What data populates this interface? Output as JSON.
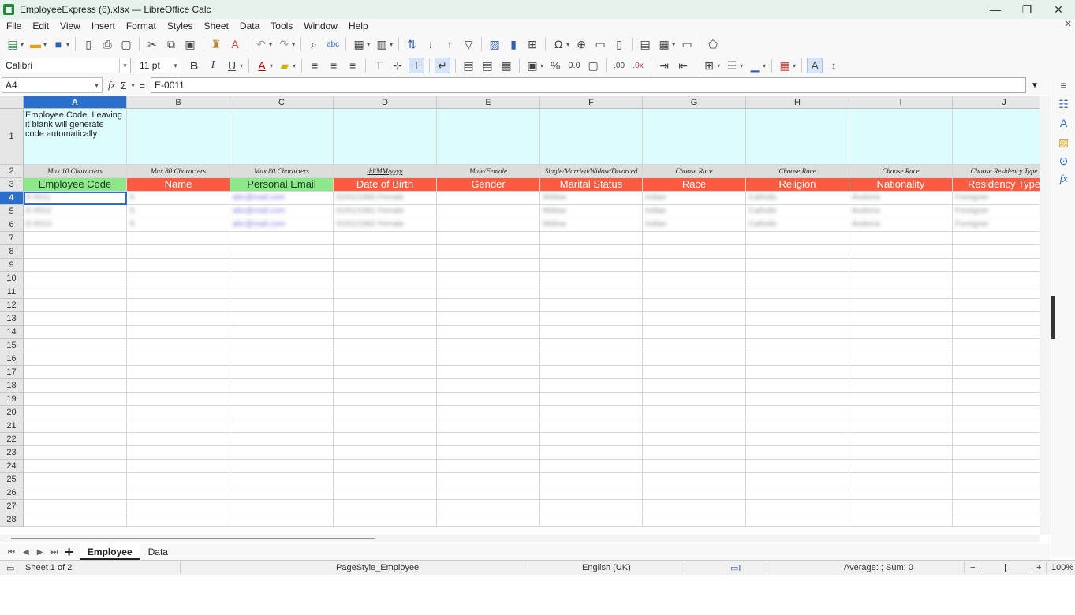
{
  "window": {
    "title": "EmployeeExpress (6).xlsx — LibreOffice Calc",
    "app_icon": "calc-app-icon",
    "controls": [
      "minimize",
      "restore",
      "close"
    ]
  },
  "menu": [
    "File",
    "Edit",
    "View",
    "Insert",
    "Format",
    "Styles",
    "Sheet",
    "Data",
    "Tools",
    "Window",
    "Help"
  ],
  "format_toolbar": {
    "font_name": "Calibri",
    "font_size": "11 pt"
  },
  "formula_bar": {
    "name_box": "A4",
    "content": "E-0011"
  },
  "columns": [
    {
      "letter": "A",
      "selected": true
    },
    {
      "letter": "B",
      "selected": false
    },
    {
      "letter": "C",
      "selected": false
    },
    {
      "letter": "D",
      "selected": false
    },
    {
      "letter": "E",
      "selected": false
    },
    {
      "letter": "F",
      "selected": false
    },
    {
      "letter": "G",
      "selected": false
    },
    {
      "letter": "H",
      "selected": false
    },
    {
      "letter": "I",
      "selected": false
    },
    {
      "letter": "J",
      "selected": false
    }
  ],
  "rows": {
    "numbers": [
      "1",
      "2",
      "3",
      "4",
      "5",
      "6",
      "7",
      "8",
      "9",
      "10",
      "11",
      "12",
      "13",
      "14",
      "15",
      "16",
      "17",
      "18",
      "19",
      "20",
      "21",
      "22",
      "23",
      "24",
      "25",
      "26",
      "27",
      "28"
    ],
    "selected": "4"
  },
  "sheet": {
    "row1_notes": [
      "Employee Code. Leaving it blank will generate code automatically",
      "",
      "",
      "",
      "",
      "",
      "",
      "",
      "",
      ""
    ],
    "row2_hints": [
      "Max 10 Characters",
      "Max 80 Characters",
      "Max 80 Characters",
      "dd/MM/yyyy",
      "Male/Female",
      "Single/Married/Widow/Divorced",
      "Choose Race",
      "Choose Race",
      "Choose Race",
      "Choose Residency Type"
    ],
    "row3_headers": [
      {
        "label": "Employee Code",
        "color": "#8de88b"
      },
      {
        "label": "Name",
        "color": "#fb5b41"
      },
      {
        "label": "Personal Email",
        "color": "#8de88b"
      },
      {
        "label": "Date of Birth",
        "color": "#fb5b41"
      },
      {
        "label": "Gender",
        "color": "#fb5b41"
      },
      {
        "label": "Marital Status",
        "color": "#fb5b41"
      },
      {
        "label": "Race",
        "color": "#fb5b41"
      },
      {
        "label": "Religion",
        "color": "#fb5b41"
      },
      {
        "label": "Nationality",
        "color": "#fb5b41"
      },
      {
        "label": "Residency Type",
        "color": "#fb5b41"
      }
    ],
    "blurred_data_rows": [
      [
        "E-0011",
        "S",
        "abc@mail.com",
        "01/01/1990 Female",
        "",
        "Widow",
        "Indian",
        "Catholic",
        "Andorra",
        "Foreigner"
      ],
      [
        "E-0012",
        "S",
        "abc@mail.com",
        "01/01/1991 Female",
        "",
        "Widow",
        "Indian",
        "Catholic",
        "Andorra",
        "Foreigner"
      ],
      [
        "E-0013",
        "S",
        "abc@mail.com",
        "01/01/1992 Female",
        "",
        "Widow",
        "Indian",
        "Catholic",
        "Andorra",
        "Foreigner"
      ]
    ]
  },
  "sheet_tabs": [
    {
      "name": "Employee",
      "active": true
    },
    {
      "name": "Data",
      "active": false
    }
  ],
  "status_bar": {
    "sheet_position": "Sheet 1 of 2",
    "page_style": "PageStyle_Employee",
    "language": "English (UK)",
    "summary": "Average: ; Sum: 0",
    "zoom": "100%"
  },
  "colors": {
    "title_bar": "#e8f2ec",
    "selection": "#2a6fc9",
    "note_row_fill": "#dcfcfe",
    "hint_row_fill": "#dddddd",
    "header_green": "#8de88b",
    "header_red": "#fb5b41"
  }
}
